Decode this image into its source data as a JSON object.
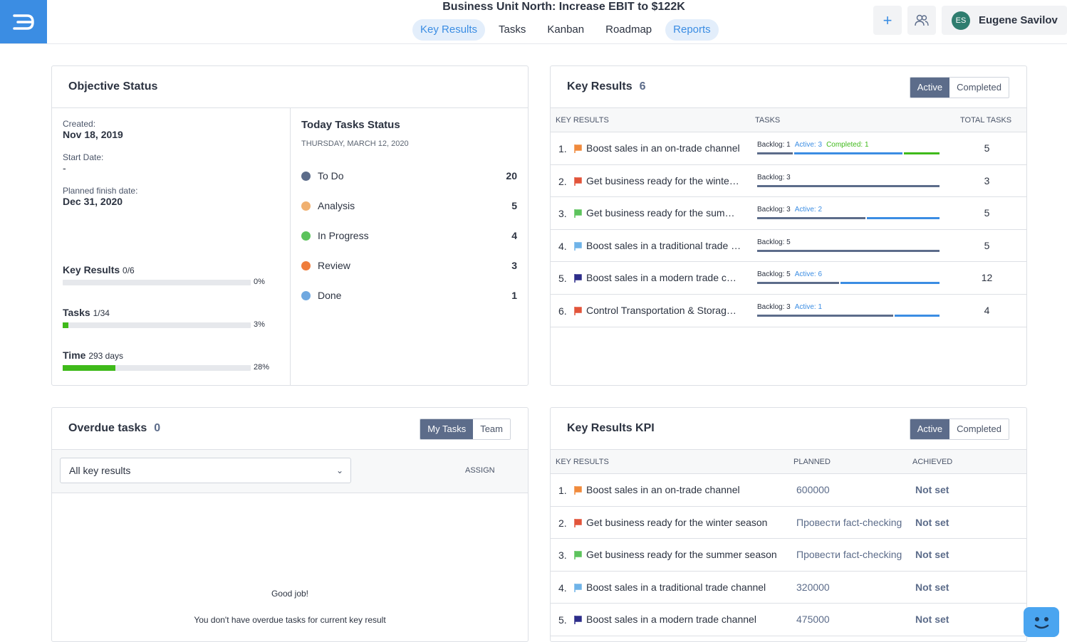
{
  "header": {
    "title": "Business Unit North: Increase EBIT to $122K",
    "tabs": [
      {
        "label": "Key Results",
        "active": true
      },
      {
        "label": "Tasks",
        "active": false
      },
      {
        "label": "Kanban",
        "active": false
      },
      {
        "label": "Roadmap",
        "active": false
      },
      {
        "label": "Reports",
        "active": true
      }
    ],
    "add_icon": "plus-icon",
    "team_icon": "users-icon",
    "user": {
      "initials": "ES",
      "name": "Eugene Savilov"
    }
  },
  "objective_status": {
    "title": "Objective Status",
    "created_label": "Created:",
    "created_value": "Nov 18, 2019",
    "start_label": "Start Date:",
    "start_value": "-",
    "finish_label": "Planned finish date:",
    "finish_value": "Dec 31, 2020",
    "progress": [
      {
        "label": "Key Results",
        "sub": "0/6",
        "pct_text": "0%",
        "value": 0
      },
      {
        "label": "Tasks",
        "sub": "1/34",
        "pct_text": "3%",
        "value": 3
      },
      {
        "label": "Time",
        "sub": "293 days",
        "pct_text": "28%",
        "value": 28
      }
    ],
    "today": {
      "title": "Today Tasks Status",
      "date": "THURSDAY, MARCH 12, 2020",
      "statuses": [
        {
          "label": "To Do",
          "count": "20",
          "color": "#5c6c8a"
        },
        {
          "label": "Analysis",
          "count": "5",
          "color": "#f0b070"
        },
        {
          "label": "In Progress",
          "count": "4",
          "color": "#5cc35c"
        },
        {
          "label": "Review",
          "count": "3",
          "color": "#ef7d3c"
        },
        {
          "label": "Done",
          "count": "1",
          "color": "#6fa8e0"
        }
      ]
    }
  },
  "key_results": {
    "title": "Key Results",
    "count": "6",
    "toggle": [
      "Active",
      "Completed"
    ],
    "columns": [
      "KEY RESULTS",
      "TASKS",
      "TOTAL TASKS"
    ],
    "rows": [
      {
        "idx": "1.",
        "flag_color": "#f08a3c",
        "name": "Boost sales in an on-trade channel",
        "labels": [
          {
            "text": "Backlog: 1",
            "color": "#2c3341"
          },
          {
            "text": "Active: 3",
            "color": "#3b8de3"
          },
          {
            "text": "Completed: 1",
            "color": "#3fba1a"
          }
        ],
        "segments": [
          {
            "value": 1,
            "color": "#5c6c8a"
          },
          {
            "value": 3,
            "color": "#3b8de3"
          },
          {
            "value": 1,
            "color": "#3fba1a"
          }
        ],
        "total": "5"
      },
      {
        "idx": "2.",
        "flag_color": "#e2543a",
        "name": "Get business ready for the winter season",
        "labels": [
          {
            "text": "Backlog: 3",
            "color": "#2c3341"
          }
        ],
        "segments": [
          {
            "value": 3,
            "color": "#5c6c8a"
          }
        ],
        "total": "3"
      },
      {
        "idx": "3.",
        "flag_color": "#5cc35c",
        "name": "Get business ready for the summer season",
        "labels": [
          {
            "text": "Backlog: 3",
            "color": "#2c3341"
          },
          {
            "text": "Active: 2",
            "color": "#3b8de3"
          }
        ],
        "segments": [
          {
            "value": 3,
            "color": "#5c6c8a"
          },
          {
            "value": 2,
            "color": "#3b8de3"
          }
        ],
        "total": "5"
      },
      {
        "idx": "4.",
        "flag_color": "#6fb3e8",
        "name": "Boost sales in a traditional trade channel",
        "labels": [
          {
            "text": "Backlog: 5",
            "color": "#2c3341"
          }
        ],
        "segments": [
          {
            "value": 5,
            "color": "#5c6c8a"
          }
        ],
        "total": "5"
      },
      {
        "idx": "5.",
        "flag_color": "#2d2d8a",
        "name": "Boost sales in a modern trade channel",
        "labels": [
          {
            "text": "Backlog: 5",
            "color": "#2c3341"
          },
          {
            "text": "Active: 6",
            "color": "#3b8de3"
          }
        ],
        "segments": [
          {
            "value": 5,
            "color": "#5c6c8a"
          },
          {
            "value": 6,
            "color": "#3b8de3"
          }
        ],
        "total": "12"
      },
      {
        "idx": "6.",
        "flag_color": "#e2543a",
        "name": "Control Transportation & Storage costs",
        "labels": [
          {
            "text": "Backlog: 3",
            "color": "#2c3341"
          },
          {
            "text": "Active: 1",
            "color": "#3b8de3"
          }
        ],
        "segments": [
          {
            "value": 3,
            "color": "#5c6c8a"
          },
          {
            "value": 1,
            "color": "#3b8de3"
          }
        ],
        "total": "4"
      }
    ]
  },
  "overdue": {
    "title": "Overdue tasks",
    "count": "0",
    "toggle": [
      "My Tasks",
      "Team"
    ],
    "select_value": "All key results",
    "assign_label": "ASSIGN",
    "empty_title": "Good job!",
    "empty_text": "You don't have overdue tasks for current key result"
  },
  "kpi": {
    "title": "Key Results KPI",
    "toggle": [
      "Active",
      "Completed"
    ],
    "columns": [
      "KEY RESULTS",
      "PLANNED",
      "ACHIEVED"
    ],
    "rows": [
      {
        "idx": "1.",
        "flag_color": "#f08a3c",
        "name": "Boost sales in an on-trade channel",
        "planned": "600000",
        "achieved": "Not set"
      },
      {
        "idx": "2.",
        "flag_color": "#e2543a",
        "name": "Get business ready for the winter season",
        "planned": "Провести fact-checking",
        "achieved": "Not set"
      },
      {
        "idx": "3.",
        "flag_color": "#5cc35c",
        "name": "Get business ready for the summer season",
        "planned": "Провести fact-checking",
        "achieved": "Not set"
      },
      {
        "idx": "4.",
        "flag_color": "#6fb3e8",
        "name": "Boost sales in a traditional trade channel",
        "planned": "320000",
        "achieved": "Not set"
      },
      {
        "idx": "5.",
        "flag_color": "#2d2d8a",
        "name": "Boost sales in a modern trade channel",
        "planned": "475000",
        "achieved": "Not set"
      }
    ]
  }
}
